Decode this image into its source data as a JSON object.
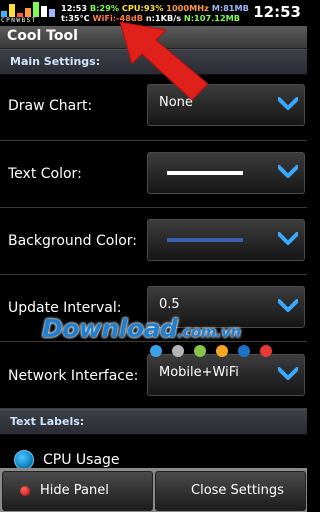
{
  "status": {
    "bar_letters": "CPNWBST",
    "line1": [
      {
        "text": "12:53 ",
        "color": "#ffffff"
      },
      {
        "text": "B:29% ",
        "color": "#7CFC4C"
      },
      {
        "text": "CPU:93% ",
        "color": "#FFE030"
      },
      {
        "text": "1000MHz ",
        "color": "#FF9A3C"
      },
      {
        "text": "M:81MB",
        "color": "#9FB7FF"
      }
    ],
    "line2": [
      {
        "text": "t:35°C ",
        "color": "#ffffff"
      },
      {
        "text": "WiFi:-48dB ",
        "color": "#FF7A4A"
      },
      {
        "text": "n:1KB/s ",
        "color": "#ffffff"
      },
      {
        "text": "N:107.12MB",
        "color": "#7CFC4C"
      }
    ],
    "clock": "12:53"
  },
  "title": "Cool Tool",
  "main_settings_header": "Main Settings:",
  "settings": {
    "draw_chart": {
      "label": "Draw Chart:",
      "value": "None"
    },
    "text_color": {
      "label": "Text Color:",
      "swatch_color": "#ffffff"
    },
    "background_color": {
      "label": "Background Color:",
      "swatch_color": "#3c5fb0"
    },
    "update_interval": {
      "label": "Update Interval:",
      "value": "0.5"
    },
    "network_interface": {
      "label": "Network Interface:",
      "value": "Mobile+WiFi"
    }
  },
  "text_labels_header": "Text Labels:",
  "text_labels": {
    "cpu_usage": "CPU Usage"
  },
  "watermark": {
    "main": "Download",
    "suffix": ".com.vn"
  },
  "watermark_dot_colors": [
    "#3aa3e8",
    "#b5b5b5",
    "#8bc34a",
    "#f5a623",
    "#1e73c8",
    "#e53935"
  ],
  "buttons": {
    "hide_panel": "Hide Panel",
    "close_settings": "Close Settings"
  },
  "colors": {
    "accent_red_arrow": "#e0201b",
    "section_text": "#cfe3ff"
  }
}
